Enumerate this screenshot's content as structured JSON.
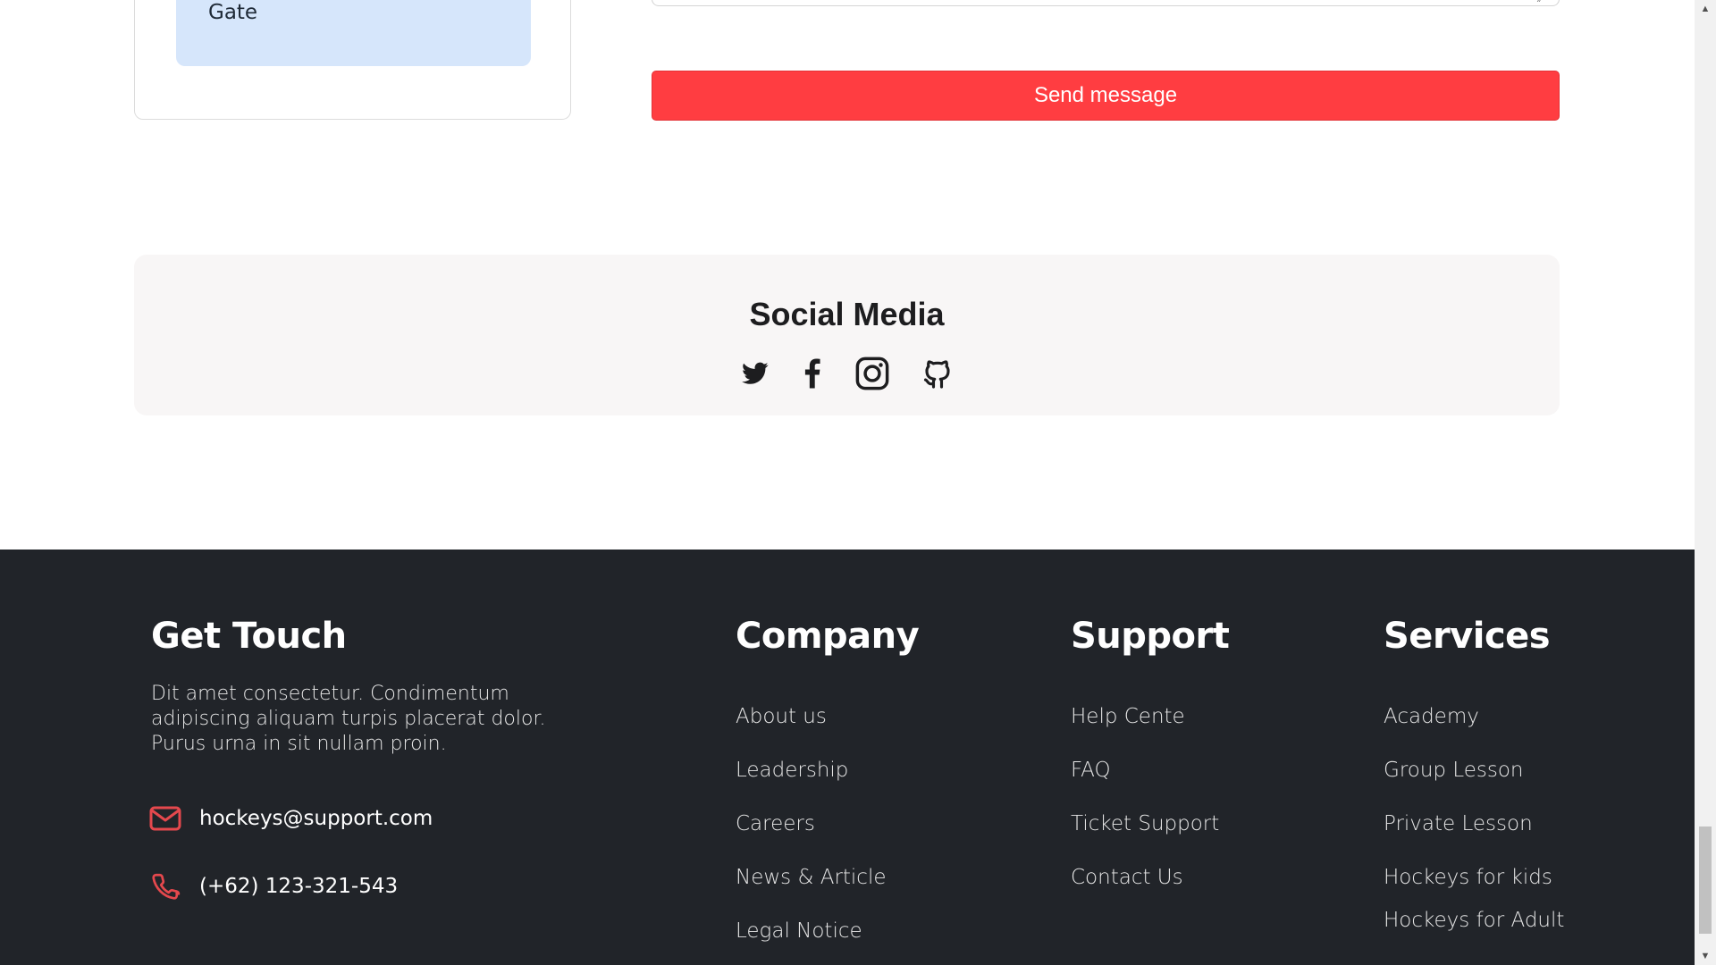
{
  "contact_card": {
    "label": "Gate"
  },
  "form": {
    "send_label": "Send message",
    "send_color": "#ff3d41"
  },
  "social": {
    "title": "Social Media",
    "icons": [
      "twitter-icon",
      "facebook-icon",
      "instagram-icon",
      "github-icon"
    ]
  },
  "footer": {
    "background": "#212429",
    "get_touch": {
      "heading": "Get Touch",
      "description": "Dit amet consectetur. Condimentum adipiscing aliquam turpis placerat dolor. Purus urna in sit nullam proin.",
      "email": "hockeys@support.com",
      "phone": "(+62) 123-321-543",
      "icon_color": "#e5484d"
    },
    "company": {
      "heading": "Company",
      "links": [
        "About us",
        "Leadership",
        "Careers",
        "News & Article",
        "Legal Notice"
      ]
    },
    "support": {
      "heading": "Support",
      "links": [
        "Help Cente",
        "FAQ",
        "Ticket Support",
        "Contact Us"
      ]
    },
    "services": {
      "heading": "Services",
      "links": [
        "Academy",
        "Group Lesson",
        "Private Lesson",
        "Hockeys for kids",
        "Hockeys for Adult"
      ]
    }
  }
}
